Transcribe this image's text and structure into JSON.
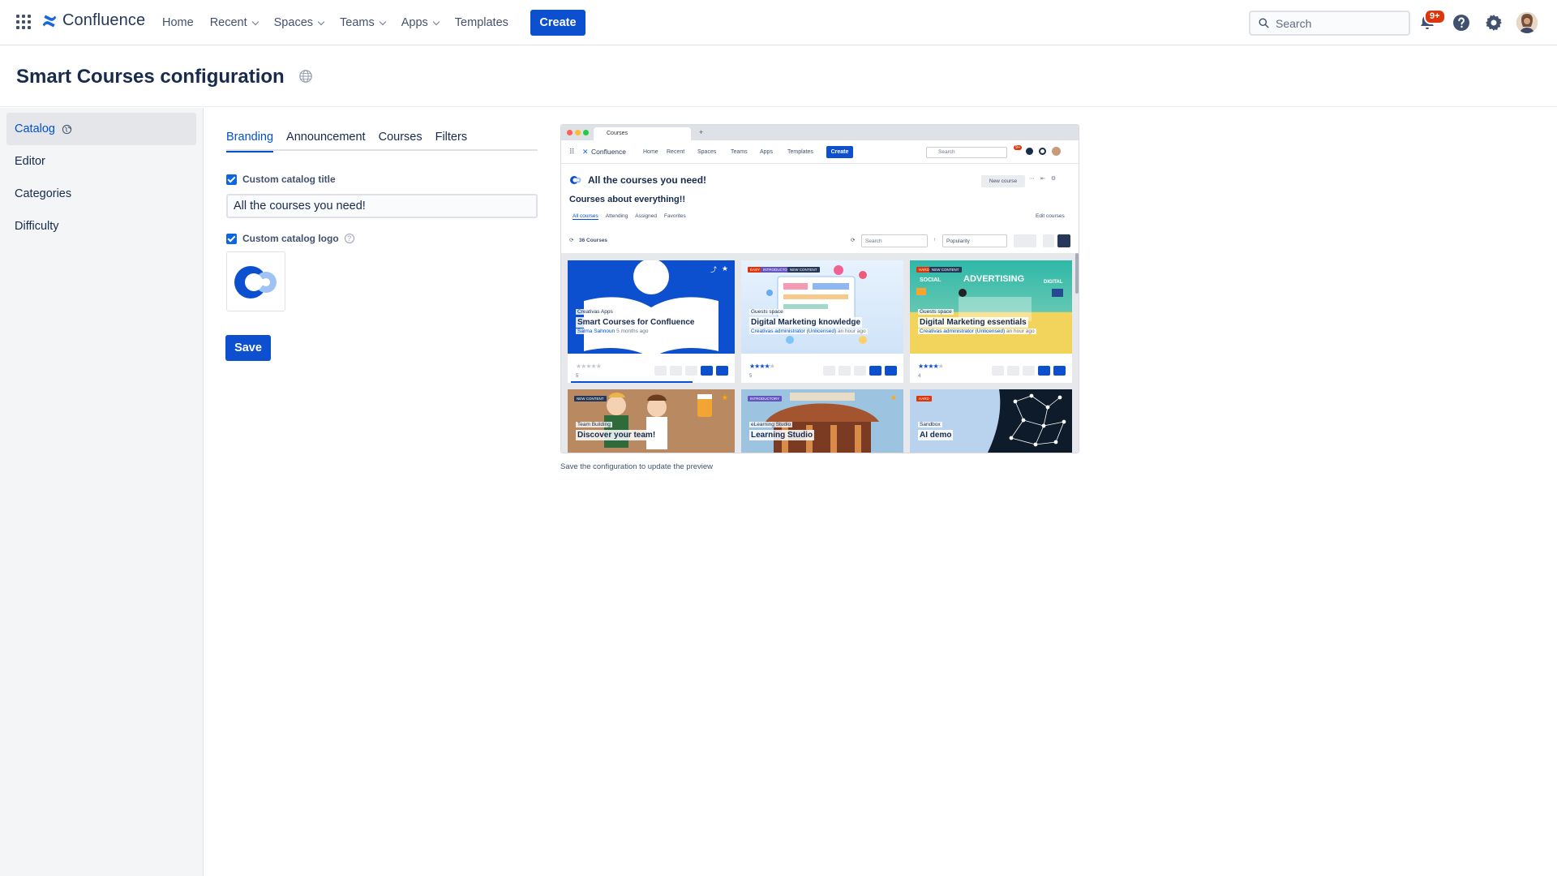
{
  "topnav": {
    "brand": "Confluence",
    "links": [
      {
        "label": "Home",
        "dropdown": false
      },
      {
        "label": "Recent",
        "dropdown": true
      },
      {
        "label": "Spaces",
        "dropdown": true
      },
      {
        "label": "Teams",
        "dropdown": true
      },
      {
        "label": "Apps",
        "dropdown": true
      },
      {
        "label": "Templates",
        "dropdown": false
      }
    ],
    "create_label": "Create",
    "search_placeholder": "Search",
    "notification_badge": "9+",
    "icons": [
      "app-switcher-icon",
      "notifications-icon",
      "help-icon",
      "settings-icon"
    ],
    "accent_color": "#0c4fcf"
  },
  "page": {
    "title": "Smart Courses configuration"
  },
  "sidebar": {
    "items": [
      {
        "label": "Catalog",
        "active": true
      },
      {
        "label": "Editor",
        "active": false
      },
      {
        "label": "Categories",
        "active": false
      },
      {
        "label": "Difficulty",
        "active": false
      }
    ]
  },
  "tabs": [
    {
      "label": "Branding",
      "active": true
    },
    {
      "label": "Announcement",
      "active": false
    },
    {
      "label": "Courses",
      "active": false
    },
    {
      "label": "Filters",
      "active": false
    }
  ],
  "form": {
    "custom_title_label": "Custom catalog title",
    "custom_title_checked": true,
    "custom_title_value": "All the courses you need!",
    "custom_logo_label": "Custom catalog logo",
    "custom_logo_checked": true,
    "save_label": "Save"
  },
  "preview": {
    "browser_tab": "Courses",
    "nav": {
      "brand": "Confluence",
      "links": [
        "Home",
        "Recent",
        "Spaces",
        "Teams",
        "Apps",
        "Templates"
      ],
      "create": "Create",
      "search": "Search",
      "badge": "9+"
    },
    "catalog_title": "All the courses you need!",
    "subtitle": "Courses about everything!!",
    "new_course": "New course",
    "tabs": [
      "All courses",
      "Attending",
      "Assigned",
      "Favorites"
    ],
    "edit_courses": "Edit courses",
    "count_label": "36 Courses",
    "search": "Search",
    "sort": "Popularity",
    "cards": [
      {
        "space": "Creativas Apps",
        "title": "Smart Courses for Confluence",
        "author": "Salma Sahnoun",
        "time": "5 months ago",
        "count": "5",
        "tags": []
      },
      {
        "space": "Guests space",
        "title": "Digital Marketing knowledge",
        "author": "Creativas administrator (Unlicensed)",
        "time": "an hour ago",
        "count": "5",
        "tags": [
          "EASY",
          "INTRODUCTORY",
          "NEW CONTENT"
        ]
      },
      {
        "space": "Guests space",
        "title": "Digital Marketing essentials",
        "author": "Creativas administrator (Unlicensed)",
        "time": "an hour ago",
        "count": "4",
        "tags": [
          "HARD",
          "NEW CONTENT"
        ]
      },
      {
        "space": "Team Building",
        "title": "Discover your team!",
        "tags": [
          "NEW CONTENT"
        ]
      },
      {
        "space": "eLearning Studio",
        "title": "Learning Studio",
        "tags": [
          "INTRODUCTORY"
        ]
      },
      {
        "space": "Sandbox",
        "title": "AI demo",
        "tags": [
          "HARD"
        ]
      }
    ],
    "banner_words": [
      "SOCIAL",
      "ADVERTISING",
      "DIGITAL"
    ],
    "caption": "Save the configuration to update the preview"
  }
}
